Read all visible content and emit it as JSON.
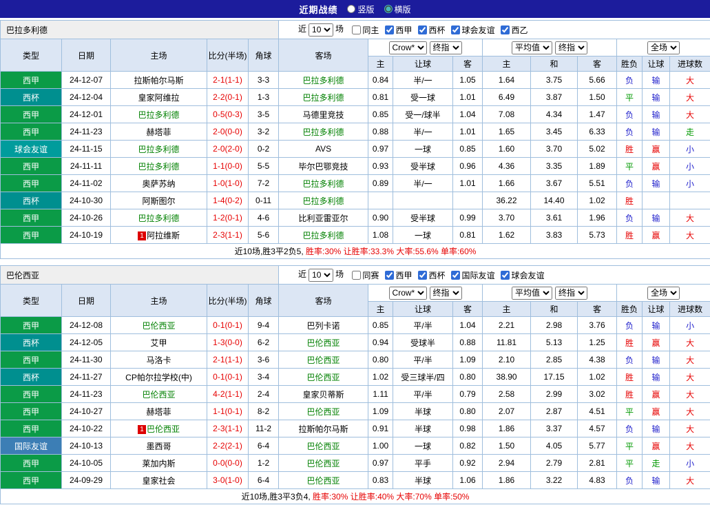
{
  "topbar": {
    "title": "近期战绩",
    "layout_options": [
      {
        "label": "竖版",
        "selected": false
      },
      {
        "label": "横版",
        "selected": true
      }
    ]
  },
  "table_header": {
    "static_cols": [
      "类型",
      "日期",
      "主场",
      "比分(半场)",
      "角球",
      "客场"
    ],
    "group1_selects": [
      "Crow*",
      "终指"
    ],
    "group1_cols": [
      "主",
      "让球",
      "客"
    ],
    "group2_selects": [
      "平均值",
      "终指"
    ],
    "group2_cols": [
      "主",
      "和",
      "客"
    ],
    "group3_selects": [
      "全场"
    ],
    "group3_cols": [
      "胜负",
      "让球",
      "进球数"
    ]
  },
  "colors": {
    "topbar_bg": "#1C1C9C",
    "header_bg": "#DCE6F4",
    "border": "#9FBEDD",
    "team_header_bg": "#EFEFEF",
    "red": "#E60000",
    "green": "#009900",
    "blue": "#2222CC",
    "team_link": "#008000",
    "badge_bg": "#DD0000",
    "type_colors": {
      "西甲": "#0B9B47",
      "西杯": "#008F8F",
      "球会友谊": "#009C9C",
      "国际友谊": "#3C7EB5"
    }
  },
  "sections": [
    {
      "team": "巴拉多利德",
      "filter": {
        "prefix": "近",
        "count": "10",
        "suffix": "场",
        "checkboxes": [
          {
            "label": "同主",
            "checked": false
          },
          {
            "label": "西甲",
            "checked": true
          },
          {
            "label": "西杯",
            "checked": true
          },
          {
            "label": "球会友谊",
            "checked": true
          },
          {
            "label": "西乙",
            "checked": true
          }
        ]
      },
      "rows": [
        {
          "type": "西甲",
          "date": "24-12-07",
          "home": "拉斯帕尔马斯",
          "home_team": false,
          "home_badge": "",
          "score": "2-1(1-1)",
          "corners": "3-3",
          "away": "巴拉多利德",
          "away_team": true,
          "odds": [
            "0.84",
            "半/一",
            "1.05"
          ],
          "avg": [
            "1.64",
            "3.75",
            "5.66"
          ],
          "results": [
            "负",
            "输",
            "大"
          ]
        },
        {
          "type": "西杯",
          "date": "24-12-04",
          "home": "皇家阿维拉",
          "home_team": false,
          "home_badge": "",
          "score": "2-2(0-1)",
          "corners": "1-3",
          "away": "巴拉多利德",
          "away_team": true,
          "odds": [
            "0.81",
            "受一球",
            "1.01"
          ],
          "avg": [
            "6.49",
            "3.87",
            "1.50"
          ],
          "results": [
            "平",
            "输",
            "大"
          ]
        },
        {
          "type": "西甲",
          "date": "24-12-01",
          "home": "巴拉多利德",
          "home_team": true,
          "home_badge": "",
          "score": "0-5(0-3)",
          "corners": "3-5",
          "away": "马德里竞技",
          "away_team": false,
          "odds": [
            "0.85",
            "受一/球半",
            "1.04"
          ],
          "avg": [
            "7.08",
            "4.34",
            "1.47"
          ],
          "results": [
            "负",
            "输",
            "大"
          ]
        },
        {
          "type": "西甲",
          "date": "24-11-23",
          "home": "赫塔菲",
          "home_team": false,
          "home_badge": "",
          "score": "2-0(0-0)",
          "corners": "3-2",
          "away": "巴拉多利德",
          "away_team": true,
          "odds": [
            "0.88",
            "半/一",
            "1.01"
          ],
          "avg": [
            "1.65",
            "3.45",
            "6.33"
          ],
          "results": [
            "负",
            "输",
            "走"
          ]
        },
        {
          "type": "球会友谊",
          "date": "24-11-15",
          "home": "巴拉多利德",
          "home_team": true,
          "home_badge": "",
          "score": "2-0(2-0)",
          "corners": "0-2",
          "away": "AVS",
          "away_team": false,
          "odds": [
            "0.97",
            "一球",
            "0.85"
          ],
          "avg": [
            "1.60",
            "3.70",
            "5.02"
          ],
          "results": [
            "胜",
            "赢",
            "小"
          ]
        },
        {
          "type": "西甲",
          "date": "24-11-11",
          "home": "巴拉多利德",
          "home_team": true,
          "home_badge": "",
          "score": "1-1(0-0)",
          "corners": "5-5",
          "away": "毕尔巴鄂竞技",
          "away_team": false,
          "odds": [
            "0.93",
            "受半球",
            "0.96"
          ],
          "avg": [
            "4.36",
            "3.35",
            "1.89"
          ],
          "results": [
            "平",
            "赢",
            "小"
          ]
        },
        {
          "type": "西甲",
          "date": "24-11-02",
          "home": "奥萨苏纳",
          "home_team": false,
          "home_badge": "",
          "score": "1-0(1-0)",
          "corners": "7-2",
          "away": "巴拉多利德",
          "away_team": true,
          "odds": [
            "0.89",
            "半/一",
            "1.01"
          ],
          "avg": [
            "1.66",
            "3.67",
            "5.51"
          ],
          "results": [
            "负",
            "输",
            "小"
          ]
        },
        {
          "type": "西杯",
          "date": "24-10-30",
          "home": "阿斯图尔",
          "home_team": false,
          "home_badge": "",
          "score": "1-4(0-2)",
          "corners": "0-11",
          "away": "巴拉多利德",
          "away_team": true,
          "odds": [
            "",
            "",
            ""
          ],
          "avg": [
            "36.22",
            "14.40",
            "1.02"
          ],
          "results": [
            "胜",
            "",
            ""
          ]
        },
        {
          "type": "西甲",
          "date": "24-10-26",
          "home": "巴拉多利德",
          "home_team": true,
          "home_badge": "",
          "score": "1-2(0-1)",
          "corners": "4-6",
          "away": "比利亚雷亚尔",
          "away_team": false,
          "odds": [
            "0.90",
            "受半球",
            "0.99"
          ],
          "avg": [
            "3.70",
            "3.61",
            "1.96"
          ],
          "results": [
            "负",
            "输",
            "大"
          ]
        },
        {
          "type": "西甲",
          "date": "24-10-19",
          "home": "阿拉维斯",
          "home_team": false,
          "home_badge": "1",
          "score": "2-3(1-1)",
          "corners": "5-6",
          "away": "巴拉多利德",
          "away_team": true,
          "odds": [
            "1.08",
            "一球",
            "0.81"
          ],
          "avg": [
            "1.62",
            "3.83",
            "5.73"
          ],
          "results": [
            "胜",
            "赢",
            "大"
          ]
        }
      ],
      "summary": {
        "prefix": "近10场,胜3平2负5, ",
        "stats": "胜率:30% 让胜率:33.3% 大率:55.6% 单率:60%"
      }
    },
    {
      "team": "巴伦西亚",
      "filter": {
        "prefix": "近",
        "count": "10",
        "suffix": "场",
        "checkboxes": [
          {
            "label": "同赛",
            "checked": false
          },
          {
            "label": "西甲",
            "checked": true
          },
          {
            "label": "西杯",
            "checked": true
          },
          {
            "label": "国际友谊",
            "checked": true
          },
          {
            "label": "球会友谊",
            "checked": true
          }
        ]
      },
      "rows": [
        {
          "type": "西甲",
          "date": "24-12-08",
          "home": "巴伦西亚",
          "home_team": true,
          "home_badge": "",
          "score": "0-1(0-1)",
          "corners": "9-4",
          "away": "巴列卡诺",
          "away_team": false,
          "odds": [
            "0.85",
            "平/半",
            "1.04"
          ],
          "avg": [
            "2.21",
            "2.98",
            "3.76"
          ],
          "results": [
            "负",
            "输",
            "小"
          ]
        },
        {
          "type": "西杯",
          "date": "24-12-05",
          "home": "艾甲",
          "home_team": false,
          "home_badge": "",
          "score": "1-3(0-0)",
          "corners": "6-2",
          "away": "巴伦西亚",
          "away_team": true,
          "odds": [
            "0.94",
            "受球半",
            "0.88"
          ],
          "avg": [
            "11.81",
            "5.13",
            "1.25"
          ],
          "results": [
            "胜",
            "赢",
            "大"
          ]
        },
        {
          "type": "西甲",
          "date": "24-11-30",
          "home": "马洛卡",
          "home_team": false,
          "home_badge": "",
          "score": "2-1(1-1)",
          "corners": "3-6",
          "away": "巴伦西亚",
          "away_team": true,
          "odds": [
            "0.80",
            "平/半",
            "1.09"
          ],
          "avg": [
            "2.10",
            "2.85",
            "4.38"
          ],
          "results": [
            "负",
            "输",
            "大"
          ]
        },
        {
          "type": "西杯",
          "date": "24-11-27",
          "home": "CP帕尔拉学校(中)",
          "home_team": false,
          "home_badge": "",
          "score": "0-1(0-1)",
          "corners": "3-4",
          "away": "巴伦西亚",
          "away_team": true,
          "odds": [
            "1.02",
            "受三球半/四",
            "0.80"
          ],
          "avg": [
            "38.90",
            "17.15",
            "1.02"
          ],
          "results": [
            "胜",
            "输",
            "大"
          ]
        },
        {
          "type": "西甲",
          "date": "24-11-23",
          "home": "巴伦西亚",
          "home_team": true,
          "home_badge": "",
          "score": "4-2(1-1)",
          "corners": "2-4",
          "away": "皇家贝蒂斯",
          "away_team": false,
          "odds": [
            "1.11",
            "平/半",
            "0.79"
          ],
          "avg": [
            "2.58",
            "2.99",
            "3.02"
          ],
          "results": [
            "胜",
            "赢",
            "大"
          ]
        },
        {
          "type": "西甲",
          "date": "24-10-27",
          "home": "赫塔菲",
          "home_team": false,
          "home_badge": "",
          "score": "1-1(0-1)",
          "corners": "8-2",
          "away": "巴伦西亚",
          "away_team": true,
          "odds": [
            "1.09",
            "半球",
            "0.80"
          ],
          "avg": [
            "2.07",
            "2.87",
            "4.51"
          ],
          "results": [
            "平",
            "赢",
            "大"
          ]
        },
        {
          "type": "西甲",
          "date": "24-10-22",
          "home": "巴伦西亚",
          "home_team": true,
          "home_badge": "1",
          "score": "2-3(1-1)",
          "corners": "11-2",
          "away": "拉斯帕尔马斯",
          "away_team": false,
          "odds": [
            "0.91",
            "半球",
            "0.98"
          ],
          "avg": [
            "1.86",
            "3.37",
            "4.57"
          ],
          "results": [
            "负",
            "输",
            "大"
          ]
        },
        {
          "type": "国际友谊",
          "date": "24-10-13",
          "home": "墨西哥",
          "home_team": false,
          "home_badge": "",
          "score": "2-2(2-1)",
          "corners": "6-4",
          "away": "巴伦西亚",
          "away_team": true,
          "odds": [
            "1.00",
            "一球",
            "0.82"
          ],
          "avg": [
            "1.50",
            "4.05",
            "5.77"
          ],
          "results": [
            "平",
            "赢",
            "大"
          ]
        },
        {
          "type": "西甲",
          "date": "24-10-05",
          "home": "莱加内斯",
          "home_team": false,
          "home_badge": "",
          "score": "0-0(0-0)",
          "corners": "1-2",
          "away": "巴伦西亚",
          "away_team": true,
          "odds": [
            "0.97",
            "平手",
            "0.92"
          ],
          "avg": [
            "2.94",
            "2.79",
            "2.81"
          ],
          "results": [
            "平",
            "走",
            "小"
          ]
        },
        {
          "type": "西甲",
          "date": "24-09-29",
          "home": "皇家社会",
          "home_team": false,
          "home_badge": "",
          "score": "3-0(1-0)",
          "corners": "6-4",
          "away": "巴伦西亚",
          "away_team": true,
          "odds": [
            "0.83",
            "半球",
            "1.06"
          ],
          "avg": [
            "1.86",
            "3.22",
            "4.83"
          ],
          "results": [
            "负",
            "输",
            "大"
          ]
        }
      ],
      "summary": {
        "prefix": "近10场,胜3平3负4, ",
        "stats": "胜率:30% 让胜率:40% 大率:70% 单率:50%"
      }
    }
  ]
}
